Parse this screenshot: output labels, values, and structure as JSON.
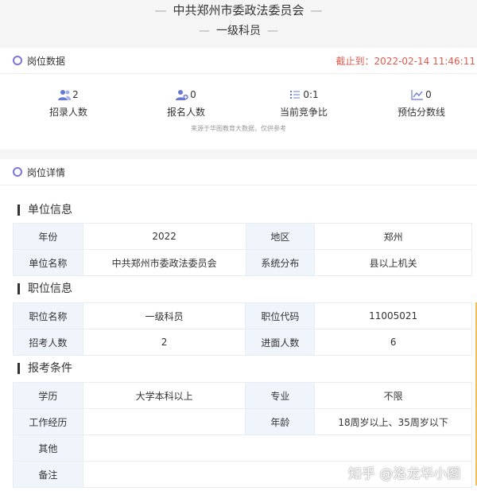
{
  "header": {
    "org_name": "中共郑州市委政法委员会",
    "position_name": "一级科员",
    "dash": "—"
  },
  "position_data": {
    "title": "岗位数据",
    "deadline": "截止到：2022-02-14 11:46:11",
    "stats": [
      {
        "icon": "users-icon",
        "value": "2",
        "label": "招录人数"
      },
      {
        "icon": "user-add-icon",
        "value": "0",
        "label": "报名人数"
      },
      {
        "icon": "list-icon",
        "value": "0:1",
        "label": "当前竞争比"
      },
      {
        "icon": "trend-icon",
        "value": "0",
        "label": "预估分数线"
      }
    ],
    "source_note": "来源于华图教育大数据，仅供参考"
  },
  "position_detail": {
    "title": "岗位详情",
    "unit_info": {
      "title": "单位信息",
      "rows": [
        [
          "年份",
          "2022",
          "地区",
          "郑州"
        ],
        [
          "单位名称",
          "中共郑州市委政法委员会",
          "系统分布",
          "县以上机关"
        ]
      ]
    },
    "job_info": {
      "title": "职位信息",
      "rows": [
        [
          "职位名称",
          "一级科员",
          "职位代码",
          "11005021"
        ],
        [
          "招考人数",
          "2",
          "进面人数",
          "6"
        ]
      ]
    },
    "requirements": {
      "title": "报考条件",
      "rows": [
        [
          "学历",
          "大学本科以上",
          "专业",
          "不限"
        ],
        [
          "工作经历",
          "",
          "年龄",
          "18周岁以上、35周岁以下"
        ]
      ],
      "other_label": "其他",
      "other_value": "",
      "remark_label": "备注",
      "remark_value": ""
    }
  },
  "watermark": "知乎 @洛龙华小图",
  "colors": {
    "accent": "#7b76d8",
    "deadline": "#e05a4e",
    "key_bg": "#f0f5fb"
  }
}
